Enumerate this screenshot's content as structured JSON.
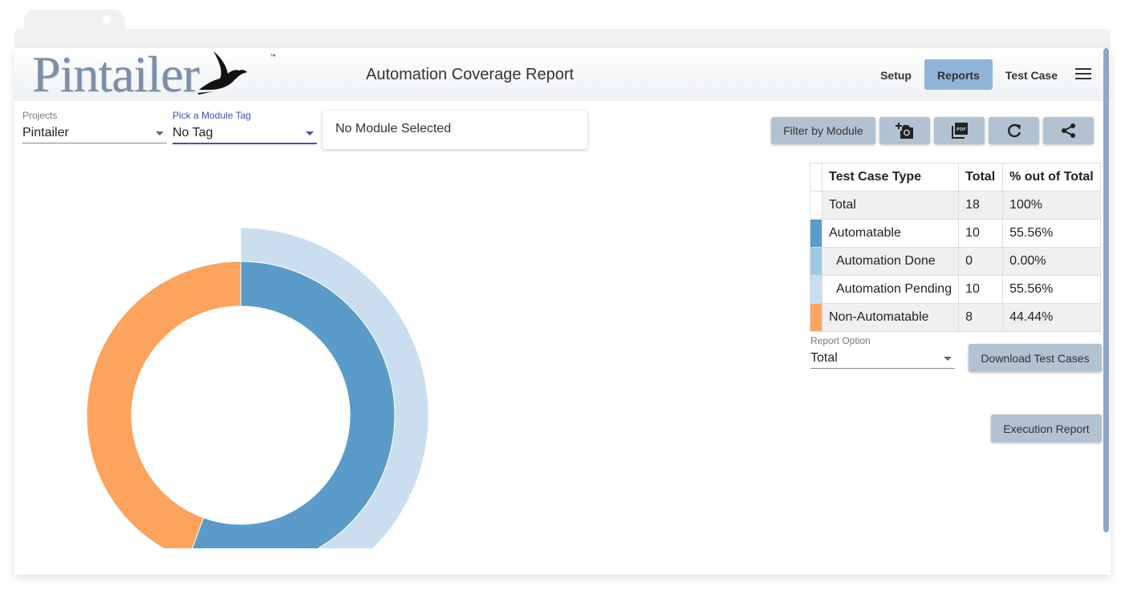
{
  "app": {
    "logo_text": "Pintailer",
    "trademark": "™",
    "page_title": "Automation Coverage Report"
  },
  "nav": {
    "items": [
      {
        "label": "Setup",
        "active": false
      },
      {
        "label": "Reports",
        "active": true
      },
      {
        "label": "Test Case",
        "active": false
      }
    ],
    "menu_icon": "hamburger-menu-icon"
  },
  "filters": {
    "project_label": "Projects",
    "project_value": "Pintailer",
    "module_tag_label": "Pick a Module Tag",
    "module_tag_value": "No Tag",
    "module_selection": "No Module Selected"
  },
  "toolbar": {
    "filter_by_module": "Filter by Module",
    "icons": [
      "add-photo-icon",
      "pdf-icon",
      "refresh-icon",
      "share-icon"
    ]
  },
  "table": {
    "headers": [
      "Test Case Type",
      "Total",
      "% out of Total"
    ],
    "rows": [
      {
        "type": "Total",
        "total": "18",
        "percent": "100%",
        "color": "#ffffff"
      },
      {
        "type": "Automatable",
        "total": "10",
        "percent": "55.56%",
        "color": "#5b9bc9"
      },
      {
        "type": "Automation Done",
        "total": "0",
        "percent": "0.00%",
        "color": "#9ec9e2"
      },
      {
        "type": "Automation Pending",
        "total": "10",
        "percent": "55.56%",
        "color": "#cadeef"
      },
      {
        "type": "Non-Automatable",
        "total": "8",
        "percent": "44.44%",
        "color": "#fca35e"
      }
    ]
  },
  "report_option": {
    "label": "Report Option",
    "value": "Total"
  },
  "buttons": {
    "download": "Download Test Cases",
    "execution": "Execution Report"
  },
  "colors": {
    "accent": "#3f51b5",
    "nav_active": "#90b4d9",
    "button": "#b2c2d1"
  },
  "chart_data": {
    "type": "pie",
    "variant": "nested-donut",
    "rings": [
      {
        "name": "inner",
        "slices": [
          {
            "label": "Automatable",
            "value": 10,
            "color": "#5b9bc9"
          },
          {
            "label": "Non-Automatable",
            "value": 8,
            "color": "#fca35e"
          }
        ]
      },
      {
        "name": "outer",
        "slices": [
          {
            "label": "Automation Done",
            "value": 0,
            "color": "#9ec9e2"
          },
          {
            "label": "Automation Pending",
            "value": 10,
            "color": "#cadeef"
          }
        ]
      }
    ],
    "total": 18
  }
}
